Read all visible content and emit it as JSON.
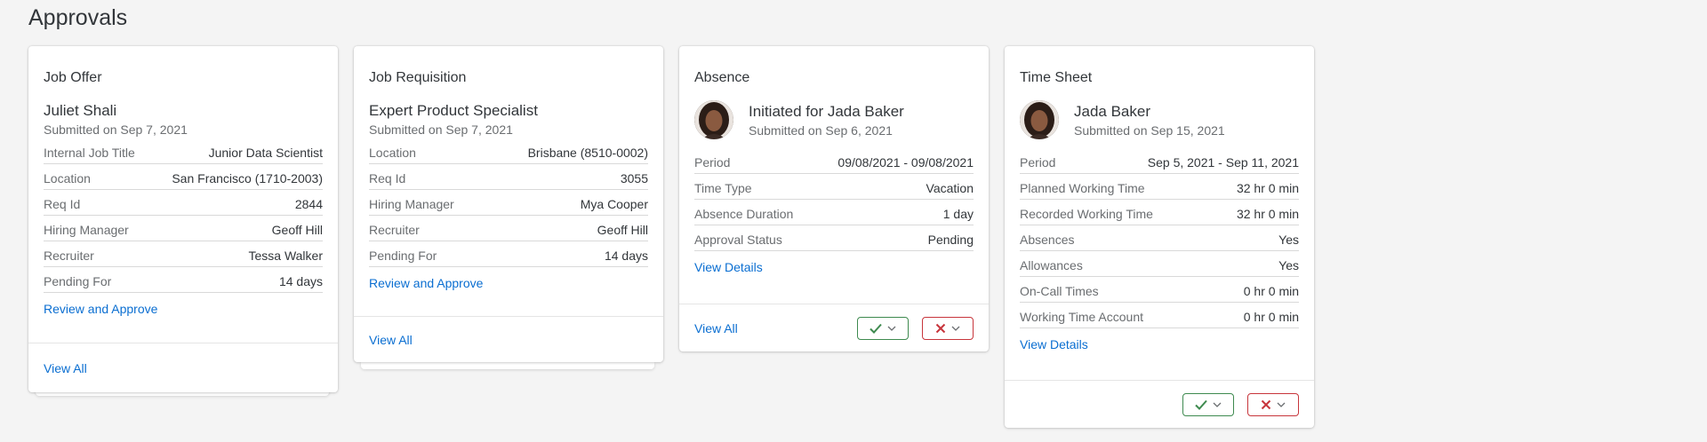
{
  "page": {
    "title": "Approvals"
  },
  "cards": {
    "job_offer": {
      "header": "Job Offer",
      "name": "Juliet Shali",
      "submitted": "Submitted on Sep 7, 2021",
      "rows": [
        {
          "label": "Internal Job Title",
          "value": "Junior Data Scientist"
        },
        {
          "label": "Location",
          "value": "San Francisco (1710-2003)"
        },
        {
          "label": "Req Id",
          "value": "2844"
        },
        {
          "label": "Hiring Manager",
          "value": "Geoff Hill"
        },
        {
          "label": "Recruiter",
          "value": "Tessa Walker"
        },
        {
          "label": "Pending For",
          "value": "14 days"
        }
      ],
      "action_link": "Review and Approve",
      "footer_link": "View All"
    },
    "job_requisition": {
      "header": "Job Requisition",
      "name": "Expert Product Specialist",
      "submitted": "Submitted on Sep 7, 2021",
      "rows": [
        {
          "label": "Location",
          "value": "Brisbane (8510-0002)"
        },
        {
          "label": "Req Id",
          "value": "3055"
        },
        {
          "label": "Hiring Manager",
          "value": "Mya Cooper"
        },
        {
          "label": "Recruiter",
          "value": "Geoff Hill"
        },
        {
          "label": "Pending For",
          "value": "14 days"
        }
      ],
      "action_link": "Review and Approve",
      "footer_link": "View All"
    },
    "absence": {
      "header": "Absence",
      "name": "Initiated for Jada Baker",
      "submitted": "Submitted on Sep 6, 2021",
      "rows": [
        {
          "label": "Period",
          "value": "09/08/2021 - 09/08/2021"
        },
        {
          "label": "Time Type",
          "value": "Vacation"
        },
        {
          "label": "Absence Duration",
          "value": "1 day"
        },
        {
          "label": "Approval Status",
          "value": "Pending"
        }
      ],
      "action_link": "View Details",
      "footer_link": "View All"
    },
    "time_sheet": {
      "header": "Time Sheet",
      "name": "Jada Baker",
      "submitted": "Submitted on Sep 15, 2021",
      "rows": [
        {
          "label": "Period",
          "value": "Sep 5, 2021 - Sep 11, 2021"
        },
        {
          "label": "Planned Working Time",
          "value": "32 hr 0 min"
        },
        {
          "label": "Recorded Working Time",
          "value": "32 hr 0 min"
        },
        {
          "label": "Absences",
          "value": "Yes"
        },
        {
          "label": "Allowances",
          "value": "Yes"
        },
        {
          "label": "On-Call Times",
          "value": "0 hr 0 min"
        },
        {
          "label": "Working Time Account",
          "value": "0 hr 0 min"
        }
      ],
      "action_link": "View Details"
    }
  },
  "colors": {
    "accept": "#3e8a4f",
    "reject": "#c7353b",
    "link": "#0a6ed1"
  },
  "icons": {
    "accept": "checkmark-icon",
    "reject": "cross-icon",
    "dropdown": "chevron-down-icon"
  }
}
